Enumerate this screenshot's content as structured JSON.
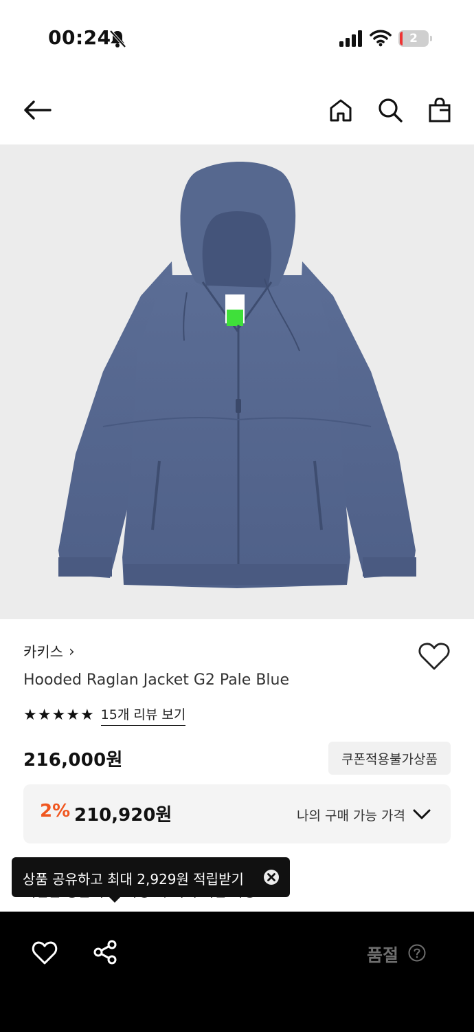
{
  "status_bar": {
    "time": "00:24",
    "battery_level": "2",
    "icons": [
      "bell-slash-icon",
      "signal-icon",
      "wifi-icon",
      "battery-icon"
    ]
  },
  "nav": {
    "icons": [
      "arrow-left-icon",
      "home-icon",
      "search-icon",
      "shopping-bag-icon"
    ]
  },
  "product": {
    "image_subject": "blue hooded raglan jacket",
    "brand": "카키스",
    "brand_chevron": "›",
    "name": "Hooded Raglan Jacket G2 Pale Blue",
    "rating_stars": 5,
    "review_link": "15개 리뷰 보기",
    "price": "216,000원",
    "coupon_badge": "쿠폰적용불가상품",
    "discount_rate": "2%",
    "discount_price": "210,920원",
    "my_price_label": "나의 구매 가능 가격"
  },
  "toast": {
    "text": "상품 공유하고 최대 2,929원 적립받기",
    "partial_underneath": "적립금 상품 후기 작성 시 최대 적립 가능"
  },
  "bottom_bar": {
    "soldout_label": "품절",
    "icons": [
      "heart-icon",
      "share-icon",
      "help-icon"
    ]
  },
  "colors": {
    "accent_discount": "#f0561f",
    "bottom_bar_bg": "#000000",
    "hero_bg": "#ececec",
    "jacket": "#55678f"
  }
}
